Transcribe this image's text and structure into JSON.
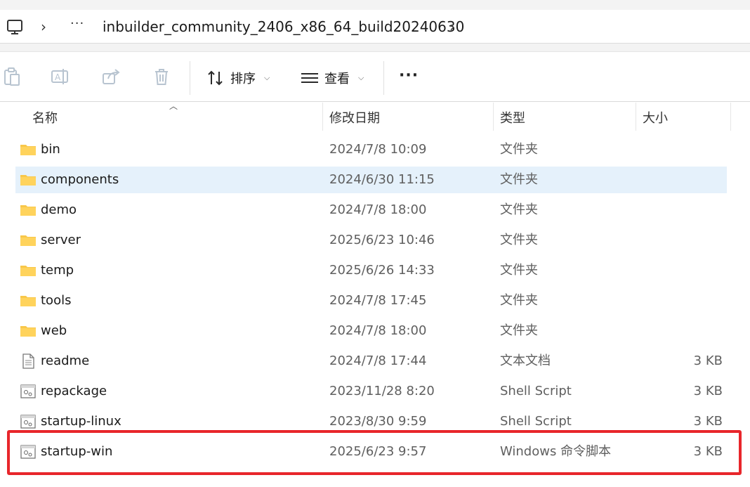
{
  "address": {
    "overflow": "···",
    "path_segment": "inbuilder_community_2406_x86_64_build20240630"
  },
  "toolbar": {
    "sort_label": "排序",
    "view_label": "查看",
    "more_label": "···"
  },
  "columns": {
    "name": "名称",
    "modified": "修改日期",
    "type": "类型",
    "size": "大小"
  },
  "files": [
    {
      "name": "bin",
      "modified": "2024/7/8 10:09",
      "type": "文件夹",
      "size": "",
      "icon": "folder-icon"
    },
    {
      "name": "components",
      "modified": "2024/6/30 11:15",
      "type": "文件夹",
      "size": "",
      "icon": "folder-icon",
      "selected": true
    },
    {
      "name": "demo",
      "modified": "2024/7/8 18:00",
      "type": "文件夹",
      "size": "",
      "icon": "folder-icon"
    },
    {
      "name": "server",
      "modified": "2025/6/23 10:46",
      "type": "文件夹",
      "size": "",
      "icon": "folder-icon"
    },
    {
      "name": "temp",
      "modified": "2025/6/26 14:33",
      "type": "文件夹",
      "size": "",
      "icon": "folder-icon"
    },
    {
      "name": "tools",
      "modified": "2024/7/8 17:45",
      "type": "文件夹",
      "size": "",
      "icon": "folder-icon"
    },
    {
      "name": "web",
      "modified": "2024/7/8 18:00",
      "type": "文件夹",
      "size": "",
      "icon": "folder-icon"
    },
    {
      "name": "readme",
      "modified": "2024/7/8 17:44",
      "type": "文本文档",
      "size": "3 KB",
      "icon": "text-document-icon"
    },
    {
      "name": "repackage",
      "modified": "2023/11/28 8:20",
      "type": "Shell Script",
      "size": "3 KB",
      "icon": "script-icon"
    },
    {
      "name": "startup-linux",
      "modified": "2023/8/30 9:59",
      "type": "Shell Script",
      "size": "3 KB",
      "icon": "script-icon"
    },
    {
      "name": "startup-win",
      "modified": "2025/6/23 9:57",
      "type": "Windows 命令脚本",
      "size": "3 KB",
      "icon": "script-icon"
    }
  ],
  "colors": {
    "selection": "#e5f1fb",
    "highlight_border": "#e8262b",
    "folder": "#f8c74a"
  }
}
